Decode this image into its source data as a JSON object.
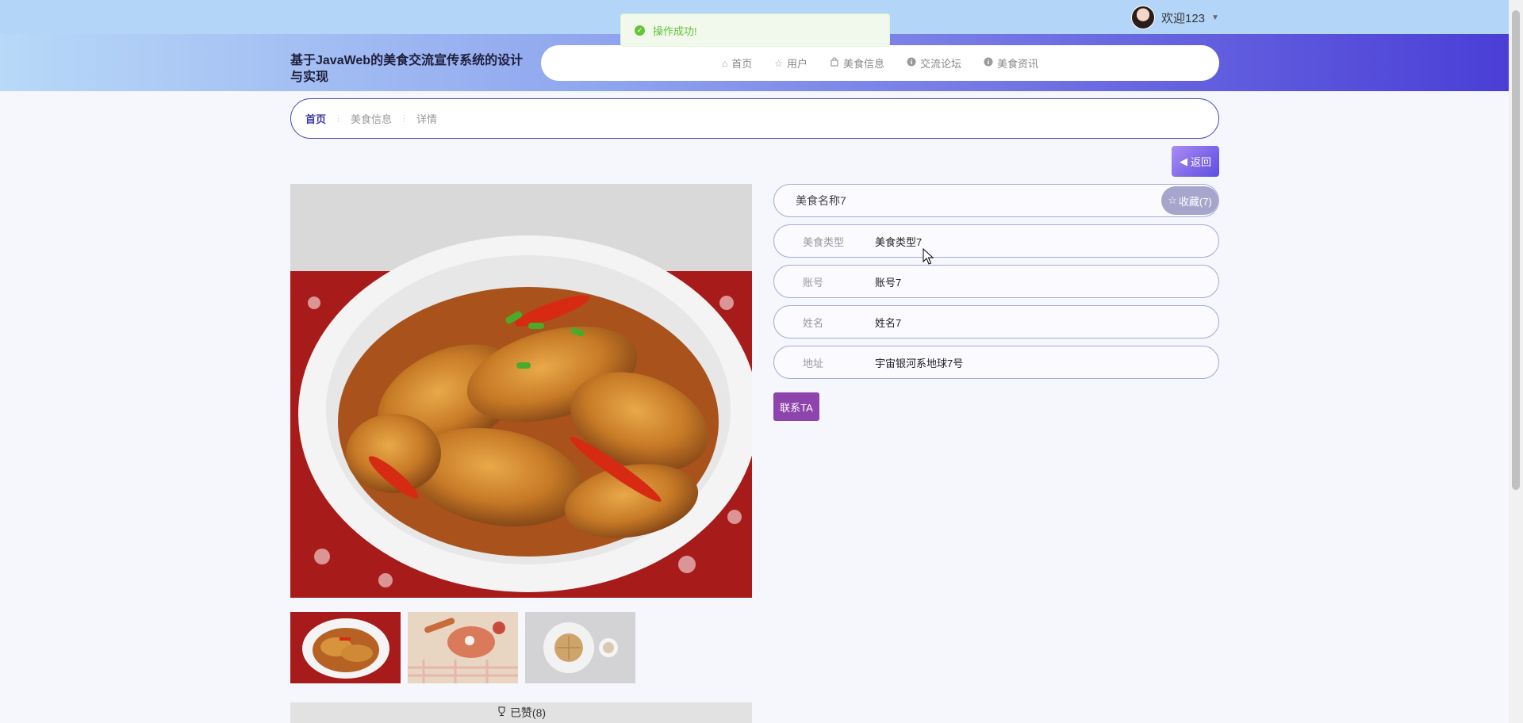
{
  "topbar": {
    "welcome": "欢迎123"
  },
  "header": {
    "site_title": "基于JavaWeb的美食交流宣传系统的设计与实现"
  },
  "nav": [
    {
      "label": "首页",
      "icon": "home-icon"
    },
    {
      "label": "用户",
      "icon": "star-icon"
    },
    {
      "label": "美食信息",
      "icon": "bag-icon"
    },
    {
      "label": "交流论坛",
      "icon": "info-circle-icon"
    },
    {
      "label": "美食资讯",
      "icon": "info-circle-icon"
    }
  ],
  "breadcrumb": {
    "home": "首页",
    "items": [
      "美食信息",
      "详情"
    ]
  },
  "back_label": "返回",
  "food": {
    "name": "美食名称7",
    "favorite_label": "收藏(7)",
    "fields": [
      {
        "label": "美食类型",
        "value": "美食类型7"
      },
      {
        "label": "账号",
        "value": "账号7"
      },
      {
        "label": "姓名",
        "value": "姓名7"
      },
      {
        "label": "地址",
        "value": "宇宙银河系地球7号"
      }
    ],
    "contact_label": "联系TA",
    "like_label": "已赞(8)"
  },
  "toast": {
    "message": "操作成功!"
  }
}
